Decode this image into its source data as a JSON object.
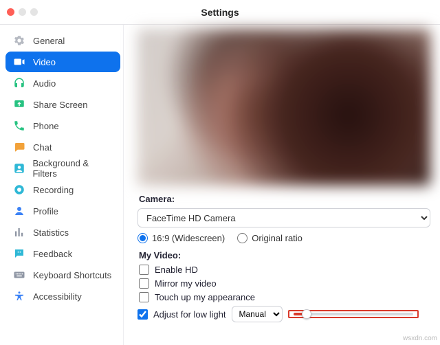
{
  "window": {
    "title": "Settings"
  },
  "sidebar": {
    "items": [
      {
        "label": "General"
      },
      {
        "label": "Video"
      },
      {
        "label": "Audio"
      },
      {
        "label": "Share Screen"
      },
      {
        "label": "Phone"
      },
      {
        "label": "Chat"
      },
      {
        "label": "Background & Filters"
      },
      {
        "label": "Recording"
      },
      {
        "label": "Profile"
      },
      {
        "label": "Statistics"
      },
      {
        "label": "Feedback"
      },
      {
        "label": "Keyboard Shortcuts"
      },
      {
        "label": "Accessibility"
      }
    ],
    "selected_index": 1
  },
  "main": {
    "camera_section_label": "Camera:",
    "camera_selected": "FaceTime HD Camera",
    "ratio": {
      "widescreen_label": "16:9 (Widescreen)",
      "original_label": "Original ratio",
      "selected": "widescreen"
    },
    "my_video_label": "My Video:",
    "options": {
      "enable_hd": {
        "label": "Enable HD",
        "checked": false
      },
      "mirror": {
        "label": "Mirror my video",
        "checked": false
      },
      "touch_up": {
        "label": "Touch up my appearance",
        "checked": false
      },
      "adjust_low_light": {
        "label": "Adjust for low light",
        "checked": true,
        "mode": "Manual",
        "slider_value": 8,
        "slider_min": 0,
        "slider_max": 100
      }
    }
  },
  "watermark": "wsxdn.com"
}
